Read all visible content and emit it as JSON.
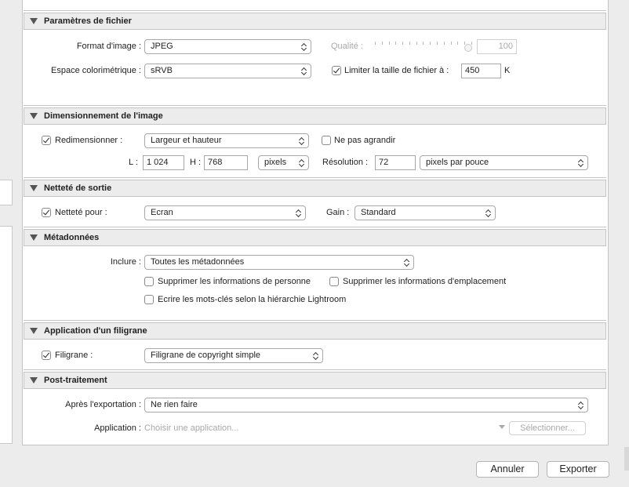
{
  "file_settings": {
    "header": "Paramètres de fichier",
    "format_label": "Format d'image :",
    "format_value": "JPEG",
    "quality_label": "Qualité :",
    "quality_value": "100",
    "quality_fraction": 1.0,
    "colorspace_label": "Espace colorimétrique :",
    "colorspace_value": "sRVB",
    "limit_label": "Limiter la taille de fichier à :",
    "limit_checked": true,
    "limit_value": "450",
    "limit_unit": "K"
  },
  "sizing": {
    "header": "Dimensionnement de l'image",
    "resize_label": "Redimensionner :",
    "resize_checked": true,
    "resize_mode": "Largeur et hauteur",
    "no_enlarge_label": "Ne pas agrandir",
    "no_enlarge_checked": false,
    "w_label": "L :",
    "w_value": "1 024",
    "h_label": "H :",
    "h_value": "768",
    "unit_value": "pixels",
    "resolution_label": "Résolution :",
    "resolution_value": "72",
    "resolution_unit": "pixels par pouce"
  },
  "sharpening": {
    "header": "Netteté de sortie",
    "sharpen_label": "Netteté pour :",
    "sharpen_checked": true,
    "sharpen_value": "Ecran",
    "gain_label": "Gain :",
    "gain_value": "Standard"
  },
  "metadata": {
    "header": "Métadonnées",
    "include_label": "Inclure :",
    "include_value": "Toutes les métadonnées",
    "remove_person_label": "Supprimer les informations de personne",
    "remove_location_label": "Supprimer les informations d'emplacement",
    "hierarchy_label": "Ecrire les mots-clés selon la hiérarchie Lightroom"
  },
  "watermark": {
    "header": "Application d'un filigrane",
    "watermark_label": "Filigrane :",
    "watermark_checked": true,
    "watermark_value": "Filigrane de copyright simple"
  },
  "post": {
    "header": "Post-traitement",
    "after_label": "Après l'exportation :",
    "after_value": "Ne rien faire",
    "app_label": "Application :",
    "app_placeholder": "Choisir une application...",
    "choose_button": "Sélectionner..."
  },
  "footer": {
    "cancel": "Annuler",
    "export": "Exporter"
  }
}
